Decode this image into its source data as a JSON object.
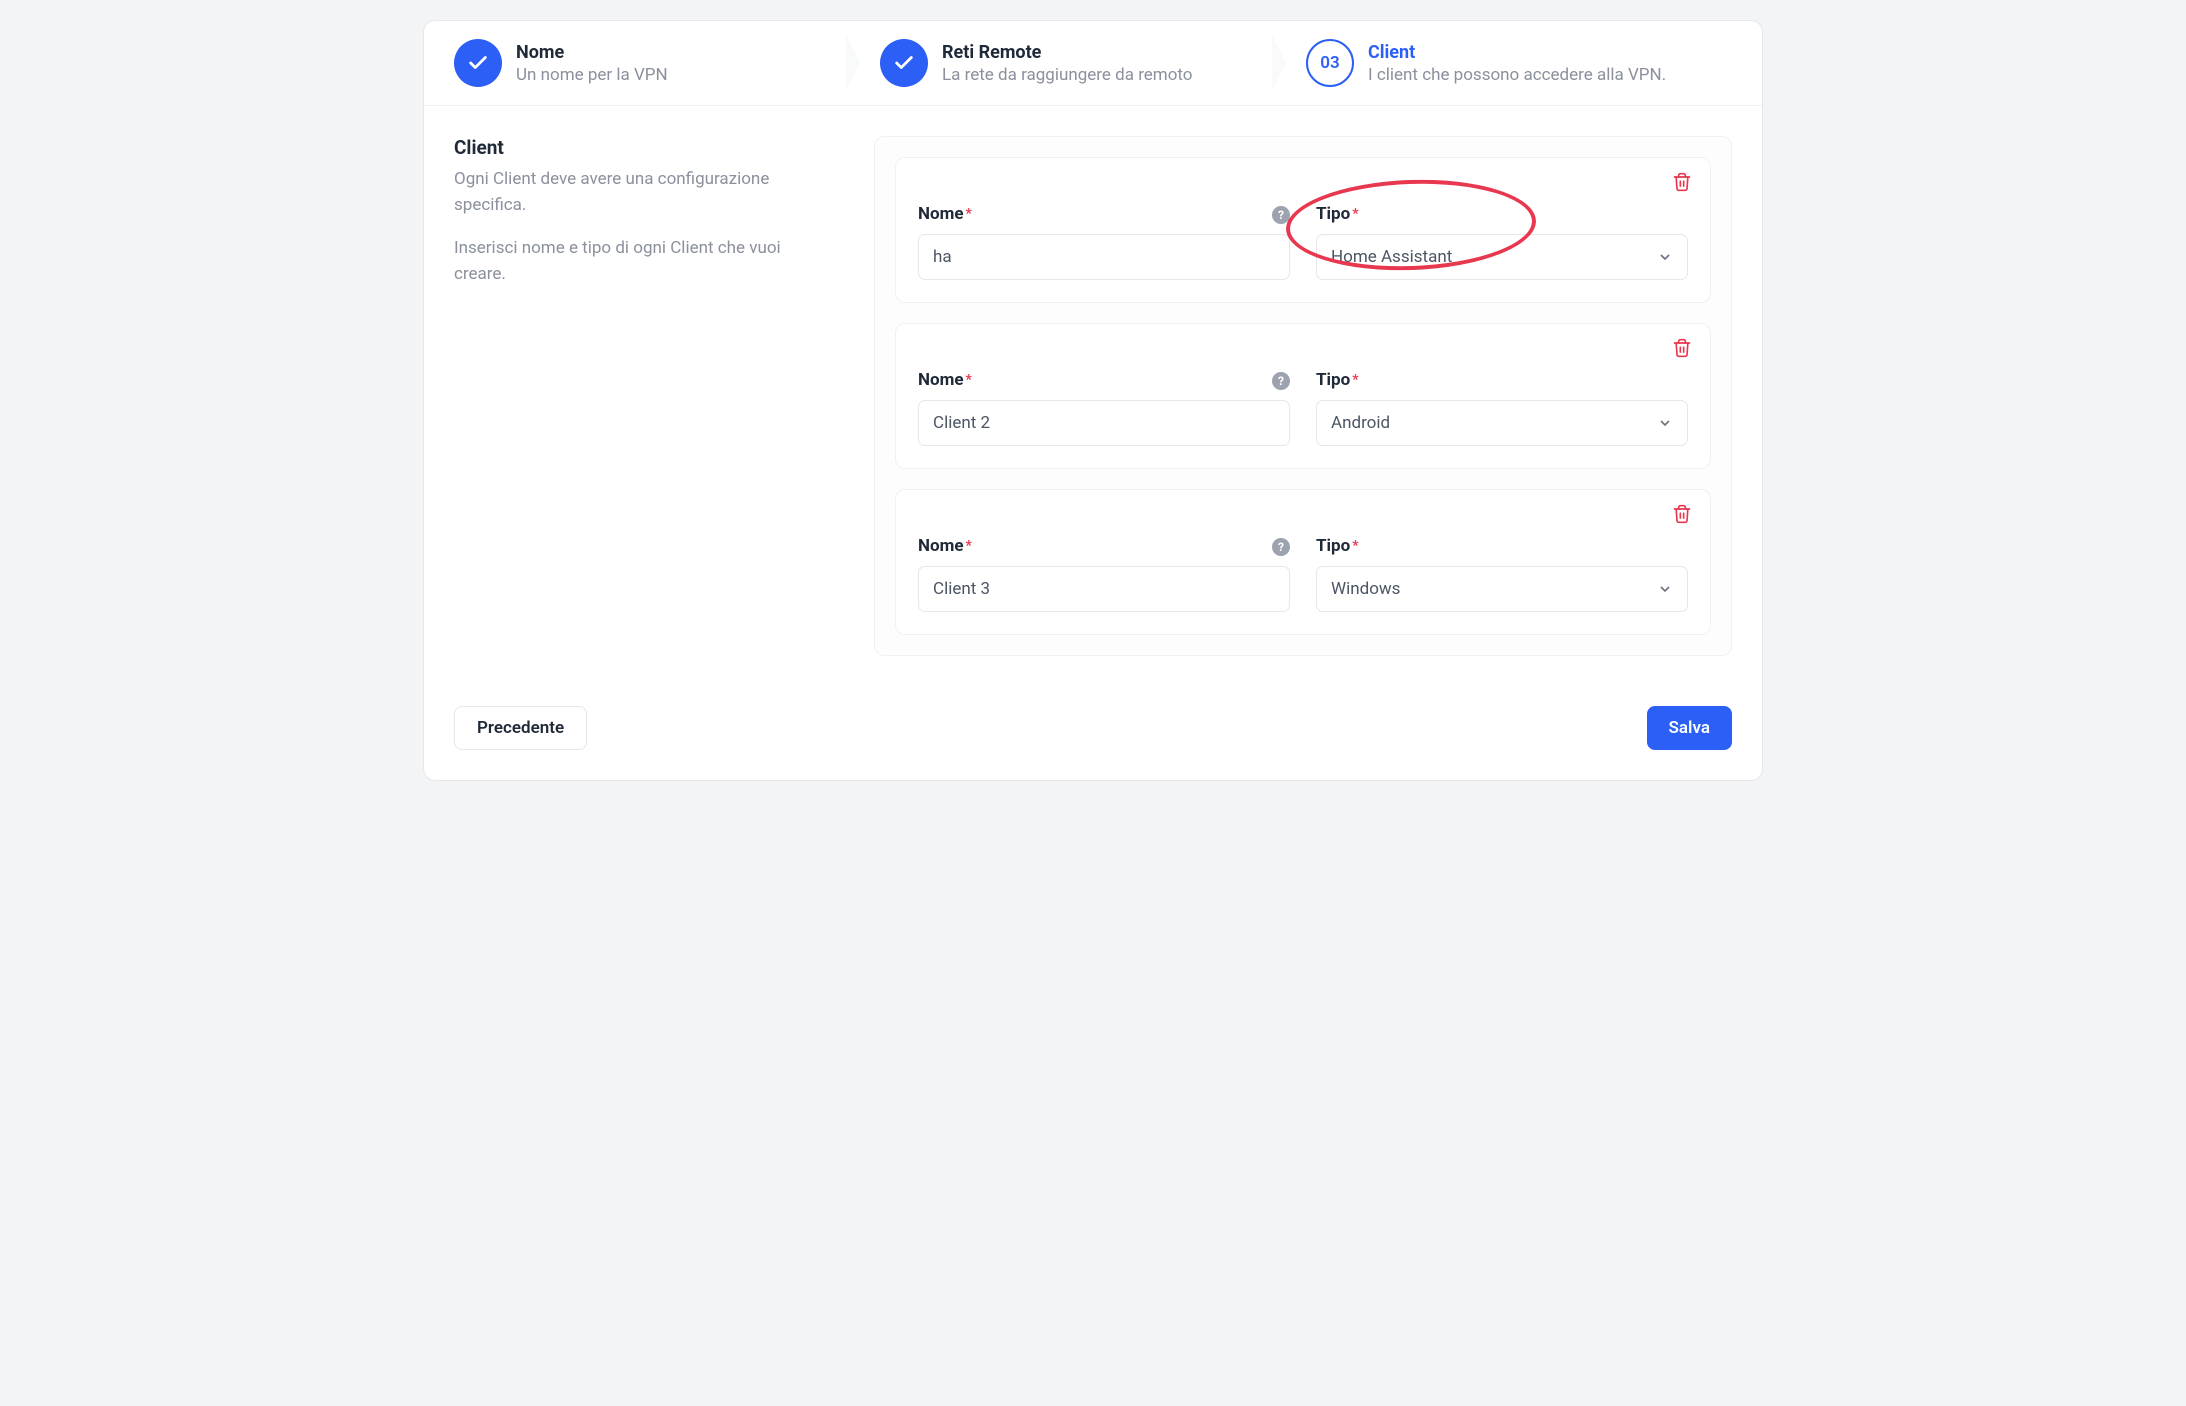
{
  "wizard": {
    "steps": [
      {
        "title": "Nome",
        "desc": "Un nome per la VPN",
        "state": "done"
      },
      {
        "title": "Reti Remote",
        "desc": "La rete da raggiungere da remoto",
        "state": "done"
      },
      {
        "title": "Client",
        "desc": "I client che possono accedere alla VPN.",
        "state": "active",
        "num": "03"
      }
    ]
  },
  "sidebar": {
    "title": "Client",
    "desc1": "Ogni Client deve avere una configurazione specifica.",
    "desc2": "Inserisci nome e tipo di ogni Client che vuoi creare."
  },
  "labels": {
    "nome": "Nome",
    "tipo": "Tipo"
  },
  "clients": [
    {
      "name": "ha",
      "type": "Home Assistant"
    },
    {
      "name": "Client 2",
      "type": "Android"
    },
    {
      "name": "Client 3",
      "type": "Windows"
    }
  ],
  "footer": {
    "prev": "Precedente",
    "save": "Salva"
  }
}
